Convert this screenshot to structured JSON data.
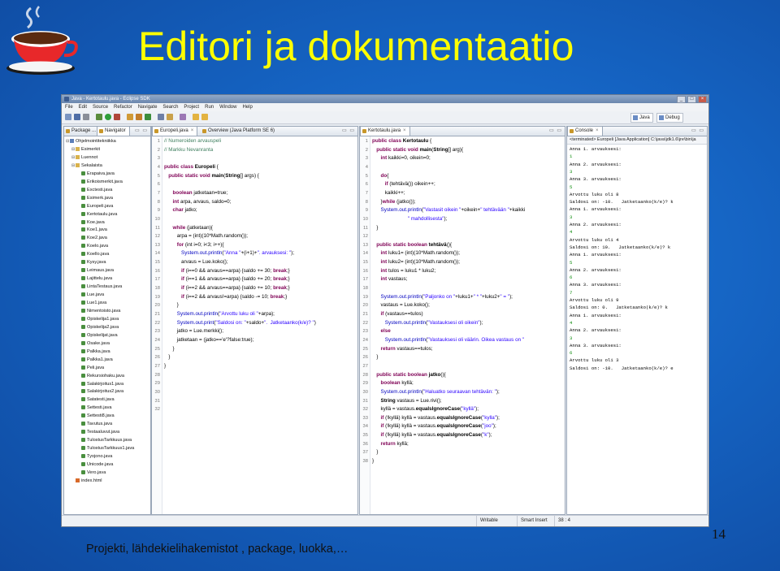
{
  "slide": {
    "title": "Editori ja dokumentaatio",
    "footer": "Projekti, lähdekielihakemistot , package, luokka,…",
    "page_number": "14"
  },
  "window": {
    "title": "Java - Kertotaulu.java - Eclipse SDK",
    "menu": [
      "File",
      "Edit",
      "Source",
      "Refactor",
      "Navigate",
      "Search",
      "Project",
      "Run",
      "Window",
      "Help"
    ],
    "perspectives": [
      "Java",
      "Debug"
    ]
  },
  "explorer": {
    "tabs": [
      "Package ...",
      "Navigator"
    ],
    "items": [
      {
        "label": "Ohjelmointitekniikka",
        "kind": "proj",
        "depth": 0
      },
      {
        "label": "Esimerkit",
        "kind": "fold",
        "depth": 1
      },
      {
        "label": "Luennot",
        "kind": "fold",
        "depth": 1
      },
      {
        "label": "Sekalaista",
        "kind": "fold",
        "depth": 1
      },
      {
        "label": "Erapaiva.java",
        "kind": "java",
        "depth": 2
      },
      {
        "label": "Erikoismerkit.java",
        "kind": "java",
        "depth": 2
      },
      {
        "label": "Exctesti.java",
        "kind": "java",
        "depth": 2
      },
      {
        "label": "Esimerk.java",
        "kind": "java",
        "depth": 2
      },
      {
        "label": "Europeli.java",
        "kind": "java",
        "depth": 2
      },
      {
        "label": "Kertotaulu.java",
        "kind": "java",
        "depth": 2
      },
      {
        "label": "Koe.java",
        "kind": "java",
        "depth": 2
      },
      {
        "label": "Koe1.java",
        "kind": "java",
        "depth": 2
      },
      {
        "label": "Koe2.java",
        "kind": "java",
        "depth": 2
      },
      {
        "label": "Koelo.java",
        "kind": "java",
        "depth": 2
      },
      {
        "label": "Koello.java",
        "kind": "java",
        "depth": 2
      },
      {
        "label": "Kysy.java",
        "kind": "java",
        "depth": 2
      },
      {
        "label": "Leimaus.java",
        "kind": "java",
        "depth": 2
      },
      {
        "label": "Lajittelu.java",
        "kind": "java",
        "depth": 2
      },
      {
        "label": "LintaTestaus.java",
        "kind": "java",
        "depth": 2
      },
      {
        "label": "Lue.java",
        "kind": "java",
        "depth": 2
      },
      {
        "label": "Lue1.java",
        "kind": "java",
        "depth": 2
      },
      {
        "label": "Nimentoisto.java",
        "kind": "java",
        "depth": 2
      },
      {
        "label": "Opiskelija1.java",
        "kind": "java",
        "depth": 2
      },
      {
        "label": "Opiskelija2.java",
        "kind": "java",
        "depth": 2
      },
      {
        "label": "Opiskelijat.java",
        "kind": "java",
        "depth": 2
      },
      {
        "label": "Osake.java",
        "kind": "java",
        "depth": 2
      },
      {
        "label": "Palkka.java",
        "kind": "java",
        "depth": 2
      },
      {
        "label": "Palkka1.java",
        "kind": "java",
        "depth": 2
      },
      {
        "label": "Peli.java",
        "kind": "java",
        "depth": 2
      },
      {
        "label": "Rekursiohaku.java",
        "kind": "java",
        "depth": 2
      },
      {
        "label": "Salakirjoitus1.java",
        "kind": "java",
        "depth": 2
      },
      {
        "label": "Salakirjoitus2.java",
        "kind": "java",
        "depth": 2
      },
      {
        "label": "Satatesti.java",
        "kind": "java",
        "depth": 2
      },
      {
        "label": "Settesti.java",
        "kind": "java",
        "depth": 2
      },
      {
        "label": "Settesti8.java",
        "kind": "java",
        "depth": 2
      },
      {
        "label": "Tavutus.java",
        "kind": "java",
        "depth": 2
      },
      {
        "label": "Testaaluvut.java",
        "kind": "java",
        "depth": 2
      },
      {
        "label": "TulostusTarkkuus.java",
        "kind": "java",
        "depth": 2
      },
      {
        "label": "TulostusTarkkuus1.java",
        "kind": "java",
        "depth": 2
      },
      {
        "label": "Tyojono.java",
        "kind": "java",
        "depth": 2
      },
      {
        "label": "Unicode.java",
        "kind": "java",
        "depth": 2
      },
      {
        "label": "Vero.java",
        "kind": "java",
        "depth": 2
      },
      {
        "label": "index.html",
        "kind": "html",
        "depth": 1
      }
    ]
  },
  "editor1": {
    "tabs": [
      "Europeli.java",
      "Overview (Java Platform SE 6)"
    ],
    "lines": [
      [
        [
          "cm",
          "// Numeroiden arvauspeli"
        ]
      ],
      [
        [
          "cm",
          "// Markku Nevanranta"
        ]
      ],
      [],
      [
        [
          "kw",
          "public class "
        ],
        [
          "b",
          "Europeli "
        ],
        [
          "",
          "{"
        ]
      ],
      [
        [
          "kw",
          "   public static void "
        ],
        [
          "b",
          "main"
        ],
        [
          "",
          "("
        ],
        [
          "b",
          "String"
        ],
        [
          "",
          "[] args) {"
        ]
      ],
      [],
      [
        [
          "kw",
          "      boolean "
        ],
        [
          "",
          "jatketaan=true;"
        ]
      ],
      [
        [
          "kw",
          "      int "
        ],
        [
          "",
          "arpa, arvaus, saldo=0;"
        ]
      ],
      [
        [
          "kw",
          "      char "
        ],
        [
          "",
          "jatko;"
        ]
      ],
      [],
      [
        [
          "kw",
          "      while "
        ],
        [
          "",
          "(jatketaan){"
        ]
      ],
      [
        [
          "",
          "         arpa = (int)(10*Math.random());"
        ]
      ],
      [
        [
          "kw",
          "         for "
        ],
        [
          "",
          "(int i=0; i<3; i++){"
        ]
      ],
      [
        [
          "fd",
          "            System.out.println"
        ],
        [
          "",
          "("
        ],
        [
          "st",
          "\"Anna \""
        ],
        [
          "",
          "+(i+1)+"
        ],
        [
          "st",
          "\". arvauksesi: \""
        ],
        [
          "",
          ");"
        ]
      ],
      [
        [
          "",
          "            arvaus = Lue.koko();"
        ]
      ],
      [
        [
          "kw",
          "            if "
        ],
        [
          "",
          "(i==0 && arvaus==arpa) {saldo += 30; "
        ],
        [
          "kw",
          "break"
        ],
        [
          "",
          ";}"
        ]
      ],
      [
        [
          "kw",
          "            if "
        ],
        [
          "",
          "(i==1 && arvaus==arpa) {saldo += 20; "
        ],
        [
          "kw",
          "break"
        ],
        [
          "",
          ";}"
        ]
      ],
      [
        [
          "kw",
          "            if "
        ],
        [
          "",
          "(i==2 && arvaus==arpa) {saldo += 10; "
        ],
        [
          "kw",
          "break"
        ],
        [
          "",
          ";}"
        ]
      ],
      [
        [
          "kw",
          "            if "
        ],
        [
          "",
          "(i==2 && arvaus!=arpa) {saldo -= 10; "
        ],
        [
          "kw",
          "break"
        ],
        [
          "",
          ";}"
        ]
      ],
      [
        [
          "",
          "         }"
        ]
      ],
      [
        [
          "fd",
          "         System.out.println"
        ],
        [
          "",
          "("
        ],
        [
          "st",
          "\"Arvottu luku oli \""
        ],
        [
          "",
          "+arpa);"
        ]
      ],
      [
        [
          "fd",
          "         System.out.print"
        ],
        [
          "",
          "("
        ],
        [
          "st",
          "\"Saldosi on: \""
        ],
        [
          "",
          "+saldo+"
        ],
        [
          "st",
          "\".  Jatketaanko(k/e)? \""
        ],
        [
          "",
          ")"
        ]
      ],
      [
        [
          "",
          "         jatko = Lue.merkki();"
        ]
      ],
      [
        [
          "",
          "         jatketaan = (jatko=='e'?false:true);"
        ]
      ],
      [
        [
          "",
          "      }"
        ]
      ],
      [
        [
          "",
          "   }"
        ]
      ],
      [
        [
          "",
          "}"
        ]
      ],
      [],
      [],
      [],
      [],
      []
    ]
  },
  "editor2": {
    "tabs": [
      "Kertotaulu.java"
    ],
    "lines": [
      [
        [
          "kw",
          "public class "
        ],
        [
          "b",
          "Kertotaulu "
        ],
        [
          "",
          "{"
        ]
      ],
      [
        [
          "kw",
          "   public static void "
        ],
        [
          "b",
          "main"
        ],
        [
          "",
          "("
        ],
        [
          "b",
          "String"
        ],
        [
          "",
          "[] arg){"
        ]
      ],
      [
        [
          "kw",
          "      int "
        ],
        [
          "",
          "kaikki=0, oikein=0;"
        ]
      ],
      [],
      [
        [
          "kw",
          "      do"
        ],
        [
          "",
          "{"
        ]
      ],
      [
        [
          "kw",
          "         if "
        ],
        [
          "",
          "(tehtävä()) oikein++;"
        ]
      ],
      [
        [
          "",
          "         kaikki++;"
        ]
      ],
      [
        [
          "",
          "      }"
        ],
        [
          "kw",
          "while "
        ],
        [
          "",
          "(jatko());"
        ]
      ],
      [
        [
          "fd",
          "      System.out.println"
        ],
        [
          "",
          "("
        ],
        [
          "st",
          "\"Vastasit oikein \""
        ],
        [
          "",
          "+oikein+"
        ],
        [
          "st",
          "\" tehtävään \""
        ],
        [
          "",
          "+kaikki"
        ]
      ],
      [
        [
          "st",
          "                         \" mahdollisesta\""
        ],
        [
          "",
          ");"
        ]
      ],
      [
        [
          "",
          "   }"
        ]
      ],
      [],
      [
        [
          "kw",
          "   public static boolean "
        ],
        [
          "b",
          "tehtävä"
        ],
        [
          "",
          "(){"
        ]
      ],
      [
        [
          "kw",
          "      int "
        ],
        [
          "",
          "luku1= (int)(10*Math.random());"
        ]
      ],
      [
        [
          "kw",
          "      int "
        ],
        [
          "",
          "luku2= (int)(10*Math.random());"
        ]
      ],
      [
        [
          "kw",
          "      int "
        ],
        [
          "",
          "tulos = luku1 * luku2;"
        ]
      ],
      [
        [
          "kw",
          "      int "
        ],
        [
          "",
          "vastaus;"
        ]
      ],
      [],
      [
        [
          "fd",
          "      System.out.println"
        ],
        [
          "",
          "("
        ],
        [
          "st",
          "\"Paljonko on \""
        ],
        [
          "",
          "+luku1+"
        ],
        [
          "st",
          "\" * \""
        ],
        [
          "",
          "+luku2+"
        ],
        [
          "st",
          "\" = \""
        ],
        [
          "",
          ");"
        ]
      ],
      [
        [
          "",
          "      vastaus = Lue.koko();"
        ]
      ],
      [
        [
          "kw",
          "      if "
        ],
        [
          "",
          "(vastaus==tulos)"
        ]
      ],
      [
        [
          "fd",
          "         System.out.println"
        ],
        [
          "",
          "("
        ],
        [
          "st",
          "\"Vastauksesi oli oikein\""
        ],
        [
          "",
          ");"
        ]
      ],
      [
        [
          "kw",
          "      else"
        ]
      ],
      [
        [
          "fd",
          "         System.out.println"
        ],
        [
          "",
          "("
        ],
        [
          "st",
          "\"Vastauksesi oli väärin. Oikea vastaus on \""
        ]
      ],
      [
        [
          "kw",
          "      return "
        ],
        [
          "",
          "vastaus==tulos;"
        ]
      ],
      [
        [
          "",
          "   }"
        ]
      ],
      [],
      [
        [
          "kw",
          "   public static boolean "
        ],
        [
          "b",
          "jatko"
        ],
        [
          "",
          "(){"
        ]
      ],
      [
        [
          "kw",
          "      boolean "
        ],
        [
          "",
          "kyllä;"
        ]
      ],
      [
        [
          "fd",
          "      System.out.println"
        ],
        [
          "",
          "("
        ],
        [
          "st",
          "\"Haluatko seuraavan tehtävän: \""
        ],
        [
          "",
          ");"
        ]
      ],
      [
        [
          "b",
          "      String "
        ],
        [
          "",
          "vastaus = Lue.rivi();"
        ]
      ],
      [
        [
          "",
          "      kyllä = vastaus."
        ],
        [
          "b",
          "equalsIgnoreCase"
        ],
        [
          "",
          "("
        ],
        [
          "st",
          "\"kyllä\""
        ],
        [
          "",
          ");"
        ]
      ],
      [
        [
          "kw",
          "      if "
        ],
        [
          "",
          "(!kyllä) kyllä = vastaus."
        ],
        [
          "b",
          "equalsIgnoreCase"
        ],
        [
          "",
          "("
        ],
        [
          "st",
          "\"kylla\""
        ],
        [
          "",
          ");"
        ]
      ],
      [
        [
          "kw",
          "      if "
        ],
        [
          "",
          "(!kyllä) kyllä = vastaus."
        ],
        [
          "b",
          "equalsIgnoreCase"
        ],
        [
          "",
          "("
        ],
        [
          "st",
          "\"joo\""
        ],
        [
          "",
          ");"
        ]
      ],
      [
        [
          "kw",
          "      if "
        ],
        [
          "",
          "(!kyllä) kyllä = vastaus."
        ],
        [
          "b",
          "equalsIgnoreCase"
        ],
        [
          "",
          "("
        ],
        [
          "st",
          "\"k\""
        ],
        [
          "",
          ");"
        ]
      ],
      [
        [
          "kw",
          "      return "
        ],
        [
          "",
          "kyllä;"
        ]
      ],
      [
        [
          "",
          "   }"
        ]
      ],
      [
        [
          "",
          "}"
        ]
      ]
    ]
  },
  "console": {
    "tab": "Console",
    "header": "<terminated> Europeli [Java Application] C:\\java\\jdk1.6\\jre\\bin\\ja",
    "lines": [
      [
        "",
        "Anna 1. arvauksesi:"
      ],
      [
        "in",
        "1"
      ],
      [
        "",
        "Anna 2. arvauksesi:"
      ],
      [
        "in",
        "3"
      ],
      [
        "",
        "Anna 3. arvauksesi:"
      ],
      [
        "in",
        "5"
      ],
      [
        "",
        "Arvottu luku oli 8"
      ],
      [
        "",
        "Saldosi on: -10.   Jatketaanko(k/e)? k"
      ],
      [
        "",
        "Anna 1. arvauksesi:"
      ],
      [
        "in",
        "3"
      ],
      [
        "",
        "Anna 2. arvauksesi:"
      ],
      [
        "in",
        "4"
      ],
      [
        "",
        "Arvottu luku oli 4"
      ],
      [
        "",
        "Saldosi on: 10.   Jatketaanko(k/e)? k"
      ],
      [
        "",
        "Anna 1. arvauksesi:"
      ],
      [
        "in",
        "5"
      ],
      [
        "",
        "Anna 2. arvauksesi:"
      ],
      [
        "in",
        "6"
      ],
      [
        "",
        "Anna 3. arvauksesi:"
      ],
      [
        "in",
        "7"
      ],
      [
        "",
        "Arvottu luku oli 9"
      ],
      [
        "",
        "Saldosi on: 0.   Jatketaanko(k/e)? k"
      ],
      [
        "",
        "Anna 1. arvauksesi:"
      ],
      [
        "in",
        "4"
      ],
      [
        "",
        "Anna 2. arvauksesi:"
      ],
      [
        "in",
        "3"
      ],
      [
        "",
        "Anna 3. arvauksesi:"
      ],
      [
        "in",
        "6"
      ],
      [
        "",
        "Arvottu luku oli 3"
      ],
      [
        "",
        "Saldosi on: -10.   Jatketaanko(k/e)? e"
      ]
    ]
  },
  "status": {
    "mode": "Writable",
    "insert": "Smart Insert",
    "position": "38 : 4"
  }
}
